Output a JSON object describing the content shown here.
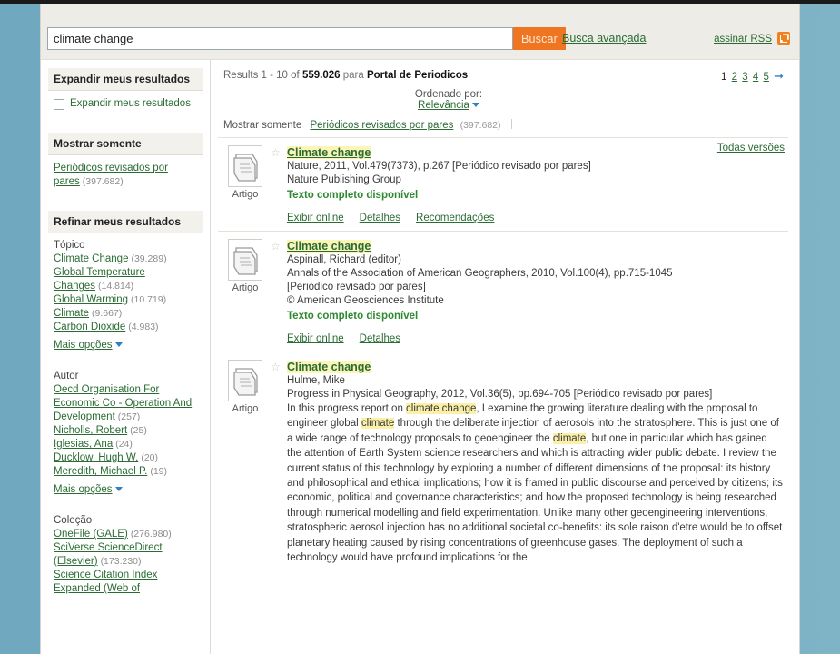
{
  "search": {
    "query": "climate change",
    "placeholder": "",
    "button_label": "Buscar",
    "advanced_label": "Busca avançada",
    "rss_label": "assinar RSS",
    "rss_icon": "rss-icon"
  },
  "sidebar": {
    "panels": [
      {
        "id": "expand",
        "title": "Expandir meus resultados",
        "checkbox_label": "Expandir meus resultados",
        "checked": false
      },
      {
        "id": "show-only",
        "title": "Mostrar somente",
        "links": [
          {
            "label": "Periódicos revisados por pares",
            "count": "(397.682)"
          }
        ]
      },
      {
        "id": "refine",
        "title": "Refinar meus resultados",
        "groups": [
          {
            "label": "Tópico",
            "items": [
              {
                "label": "Climate Change",
                "count": "(39.289)"
              },
              {
                "label": "Global Temperature Changes",
                "count": "(14.814)"
              },
              {
                "label": "Global Warming",
                "count": "(10.719)"
              },
              {
                "label": "Climate",
                "count": "(9.667)"
              },
              {
                "label": "Carbon Dioxide",
                "count": "(4.983)"
              }
            ],
            "more_label": "Mais opções"
          },
          {
            "label": "Autor",
            "items": [
              {
                "label": "Oecd Organisation For Economic Co - Operation And Development",
                "count": "(257)"
              },
              {
                "label": "Nicholls, Robert",
                "count": "(25)"
              },
              {
                "label": "Iglesias, Ana",
                "count": "(24)"
              },
              {
                "label": "Ducklow, Hugh W.",
                "count": "(20)"
              },
              {
                "label": "Meredith, Michael P.",
                "count": "(19)"
              }
            ],
            "more_label": "Mais opções"
          },
          {
            "label": "Coleção",
            "items": [
              {
                "label": "OneFile (GALE)",
                "count": "(276.980)"
              },
              {
                "label": "SciVerse ScienceDirect (Elsevier)",
                "count": "(173.230)"
              },
              {
                "label": "Science Citation Index Expanded (Web of",
                "count": ""
              }
            ],
            "more_label": ""
          }
        ]
      }
    ]
  },
  "results_header": {
    "prefix": "Results 1 - 10 of",
    "total": "559.026",
    "middle": "para",
    "scope": "Portal de Periodicos",
    "sort_label": "Ordenado por:",
    "sort_value": "Relevância",
    "show_only_label": "Mostrar somente",
    "show_only_link": "Periódicos revisados por pares",
    "show_only_count": "(397.682)"
  },
  "pagination": {
    "current": "1",
    "pages": [
      "2",
      "3",
      "4",
      "5"
    ],
    "next_icon": "arrow-right-icon"
  },
  "results": [
    {
      "icon_name": "document-stack-icon",
      "type_label": "Artigo",
      "star_icon": "star-icon",
      "title": "Climate change",
      "meta_lines": [
        "Nature, 2011, Vol.479(7373), p.267 [Periódico revisado por pares]",
        "Nature Publishing Group"
      ],
      "fulltext": "Texto completo disponível",
      "actions": [
        "Exibir online",
        "Detalhes",
        "Recomendações"
      ],
      "all_versions": "Todas versões",
      "abstract": ""
    },
    {
      "icon_name": "document-stack-icon",
      "type_label": "Artigo",
      "star_icon": "star-icon",
      "title": "Climate change",
      "meta_lines": [
        "Aspinall, Richard (editor)",
        "Annals of the Association of American Geographers, 2010, Vol.100(4), pp.715-1045",
        "[Periódico revisado por pares]",
        "© American Geosciences Institute"
      ],
      "fulltext": "Texto completo disponível",
      "actions": [
        "Exibir online",
        "Detalhes"
      ],
      "all_versions": "",
      "abstract": ""
    },
    {
      "icon_name": "document-stack-icon",
      "type_label": "Artigo",
      "star_icon": "star-icon",
      "title": "Climate change",
      "meta_lines": [
        "Hulme, Mike",
        "Progress in Physical Geography, 2012, Vol.36(5), pp.694-705 [Periódico revisado por pares]"
      ],
      "fulltext": "",
      "actions": [],
      "all_versions": "",
      "abstract_parts": [
        {
          "text": "In this progress report on ",
          "hl": false
        },
        {
          "text": "climate change",
          "hl": true
        },
        {
          "text": ", I examine the growing literature dealing with the proposal to engineer global ",
          "hl": false
        },
        {
          "text": "climate",
          "hl": true
        },
        {
          "text": " through the deliberate injection of aerosols into the stratosphere. This is just one of a wide range of technology proposals to geoengineer the ",
          "hl": false
        },
        {
          "text": "climate",
          "hl": true
        },
        {
          "text": ", but one in particular which has gained the attention of Earth System science researchers and which is attracting wider public debate. I review the current status of this technology by exploring a number of different dimensions of the proposal: its history and philosophical and ethical implications; how it is framed in public discourse and perceived by citizens; its economic, political and governance characteristics; and how the proposed technology is being researched through numerical modelling and field experimentation. Unlike many other geoengineering interventions, stratospheric aerosol injection has no additional societal co-benefits: its sole raison d'etre would be to offset planetary heating caused by rising concentrations of greenhouse gases. The deployment of such a technology would have profound implications for the",
          "hl": false
        }
      ]
    }
  ],
  "colors": {
    "link_green": "#2b6c34",
    "accent_orange": "#ef7521",
    "page_bg": "#6fa8bf",
    "highlight_yellow": "#fbf0a8"
  }
}
